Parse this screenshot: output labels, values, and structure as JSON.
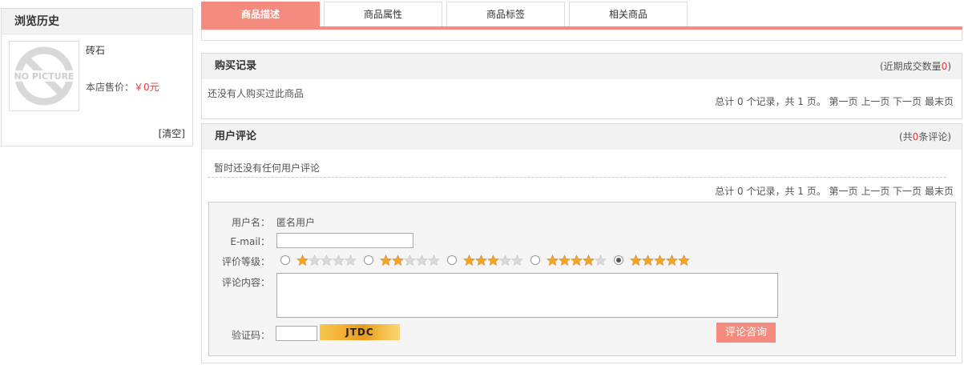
{
  "history": {
    "title": "浏览历史",
    "thumb_text": "NO PICTURE",
    "item_name": "砖石",
    "price_label": "本店售价：",
    "price_value": "￥0元",
    "clear_label": "[清空]"
  },
  "tabs": [
    {
      "label": "商品描述",
      "active": true
    },
    {
      "label": "商品属性",
      "active": false
    },
    {
      "label": "商品标签",
      "active": false
    },
    {
      "label": "相关商品",
      "active": false
    }
  ],
  "purchase": {
    "title": "购买记录",
    "extra_prefix": "(近期成交数量",
    "extra_count": "0",
    "extra_suffix": ")",
    "empty_text": "还没有人购买过此商品",
    "pager": "总计 0 个记录，共 1 页。 第一页 上一页 下一页 最末页"
  },
  "reviews": {
    "title": "用户评论",
    "extra_prefix": "(共",
    "extra_count": "0",
    "extra_suffix": "条评论)",
    "empty_text": "暂时还没有任何用户评论",
    "pager": "总计 0 个记录，共 1 页。 第一页 上一页 下一页 最末页"
  },
  "form": {
    "username_label": "用户名：",
    "username_value": "匿名用户",
    "email_label": "E-mail：",
    "email_value": "",
    "rating_label": "评价等级：",
    "rating_options": [
      1,
      2,
      3,
      4,
      5
    ],
    "rating_selected": 5,
    "content_label": "评论内容：",
    "content_value": "",
    "captcha_label": "验证码：",
    "captcha_value": "",
    "captcha_text": "JTDC",
    "submit_label": "评论咨询"
  },
  "colors": {
    "accent": "#f58a7f",
    "price": "#e4393c",
    "star_on": "#f5a623",
    "star_off": "#d9d9d9"
  }
}
